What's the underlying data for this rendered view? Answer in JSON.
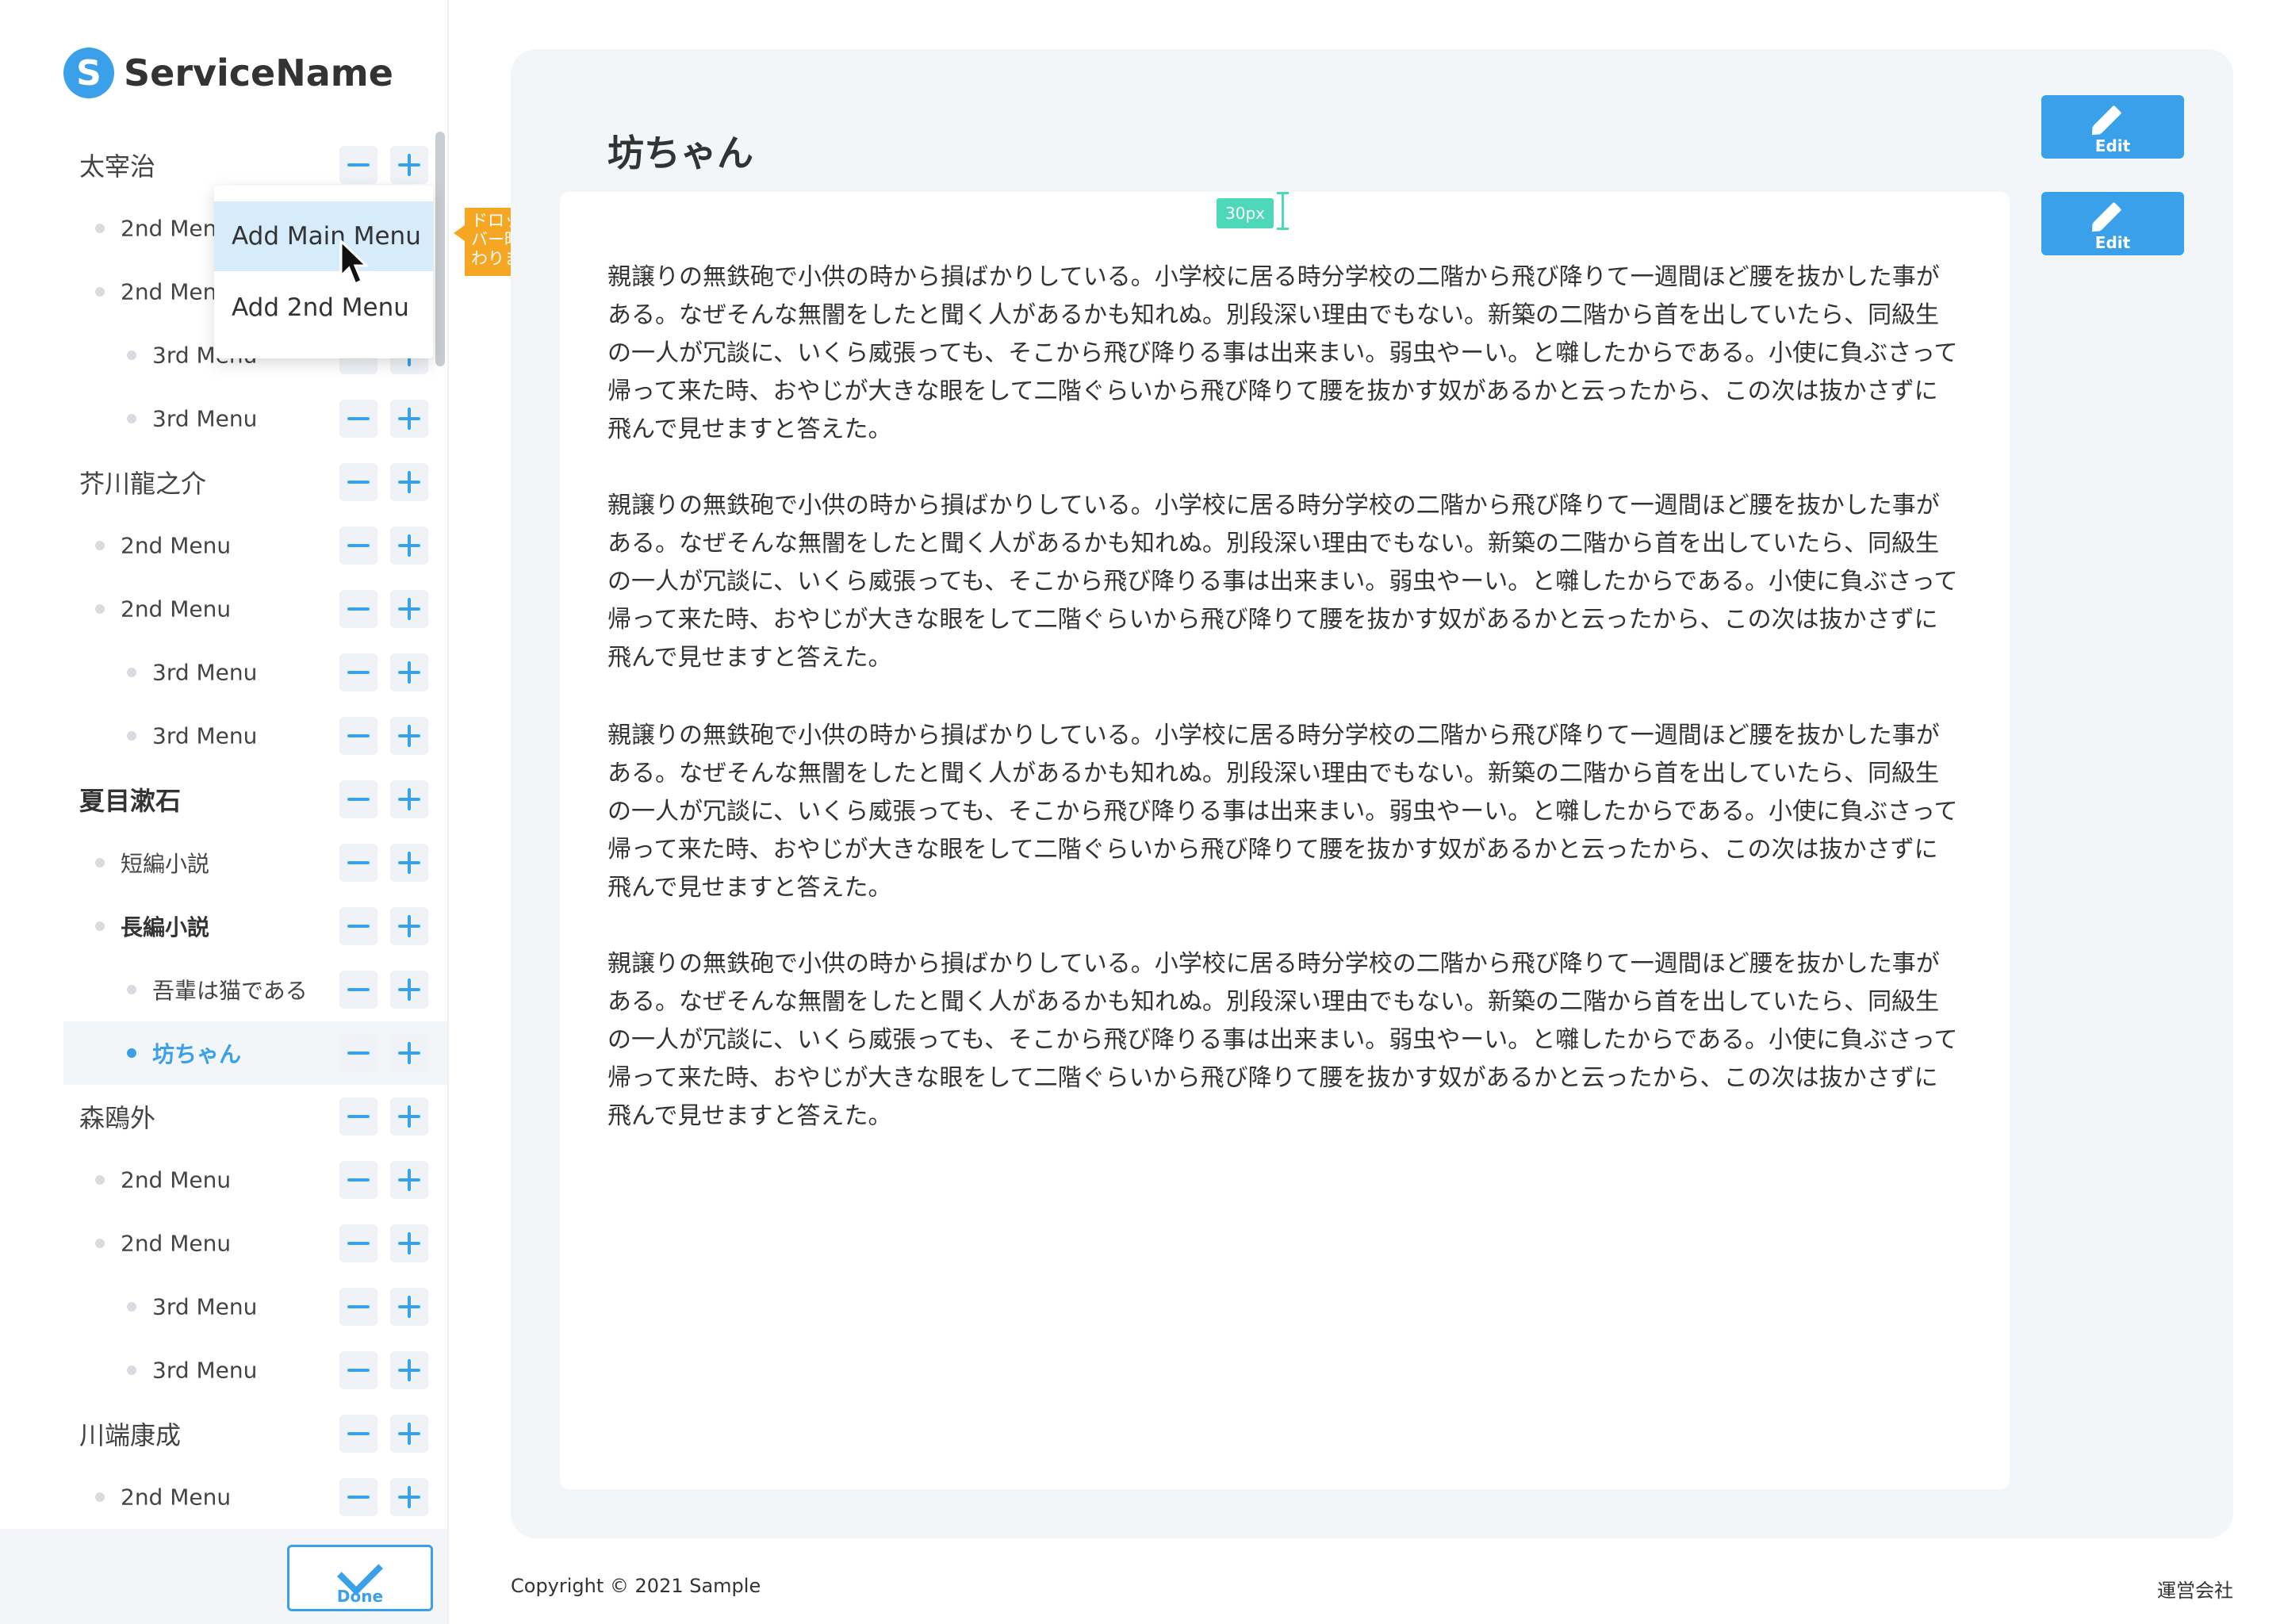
{
  "brand": {
    "logo_letter": "S",
    "name": "ServiceName"
  },
  "sidebar": {
    "items": [
      {
        "label": "太宰治",
        "level": 1
      },
      {
        "label": "2nd Menu",
        "level": 2
      },
      {
        "label": "2nd Menu",
        "level": 2
      },
      {
        "label": "3rd Menu",
        "level": 3
      },
      {
        "label": "3rd Menu",
        "level": 3
      },
      {
        "label": "芥川龍之介",
        "level": 1
      },
      {
        "label": "2nd Menu",
        "level": 2
      },
      {
        "label": "2nd Menu",
        "level": 2
      },
      {
        "label": "3rd Menu",
        "level": 3
      },
      {
        "label": "3rd Menu",
        "level": 3
      },
      {
        "label": "夏目漱石",
        "level": 1
      },
      {
        "label": "短編小説",
        "level": 2
      },
      {
        "label": "長編小説",
        "level": 2
      },
      {
        "label": "吾輩は猫である",
        "level": 3
      },
      {
        "label": "坊ちゃん",
        "level": 3
      },
      {
        "label": "森鴎外",
        "level": 1
      },
      {
        "label": "2nd Menu",
        "level": 2
      },
      {
        "label": "2nd Menu",
        "level": 2
      },
      {
        "label": "3rd Menu",
        "level": 3
      },
      {
        "label": "3rd Menu",
        "level": 3
      },
      {
        "label": "川端康成",
        "level": 1
      },
      {
        "label": "2nd Menu",
        "level": 2
      }
    ],
    "done_label": "Done"
  },
  "dropdown": {
    "items": [
      "Add Main Menu",
      "Add 2nd Menu"
    ],
    "note": "ドロップダウン ホバー時は背景色 変わります"
  },
  "main": {
    "title": "坊ちゃん",
    "edit_label": "Edit",
    "spacing_label": "30px",
    "paragraph": "親譲りの無鉄砲で小供の時から損ばかりしている。小学校に居る時分学校の二階から飛び降りて一週間ほど腰を抜かした事がある。なぜそんな無闇をしたと聞く人があるかも知れぬ。別段深い理由でもない。新築の二階から首を出していたら、同級生の一人が冗談に、いくら威張っても、そこから飛び降りる事は出来まい。弱虫やーい。と囃したからである。小使に負ぶさって帰って来た時、おやじが大きな眼をして二階ぐらいから飛び降りて腰を抜かす奴があるかと云ったから、この次は抜かさずに飛んで見せますと答えた。"
  },
  "footer": {
    "copyright": "Copyright © 2021 Sample",
    "company_link": "運営会社"
  },
  "colors": {
    "accent": "#3aa0e9",
    "note": "#f5a623",
    "spacing": "#4dd9b8",
    "panel": "#f3f6f9"
  }
}
